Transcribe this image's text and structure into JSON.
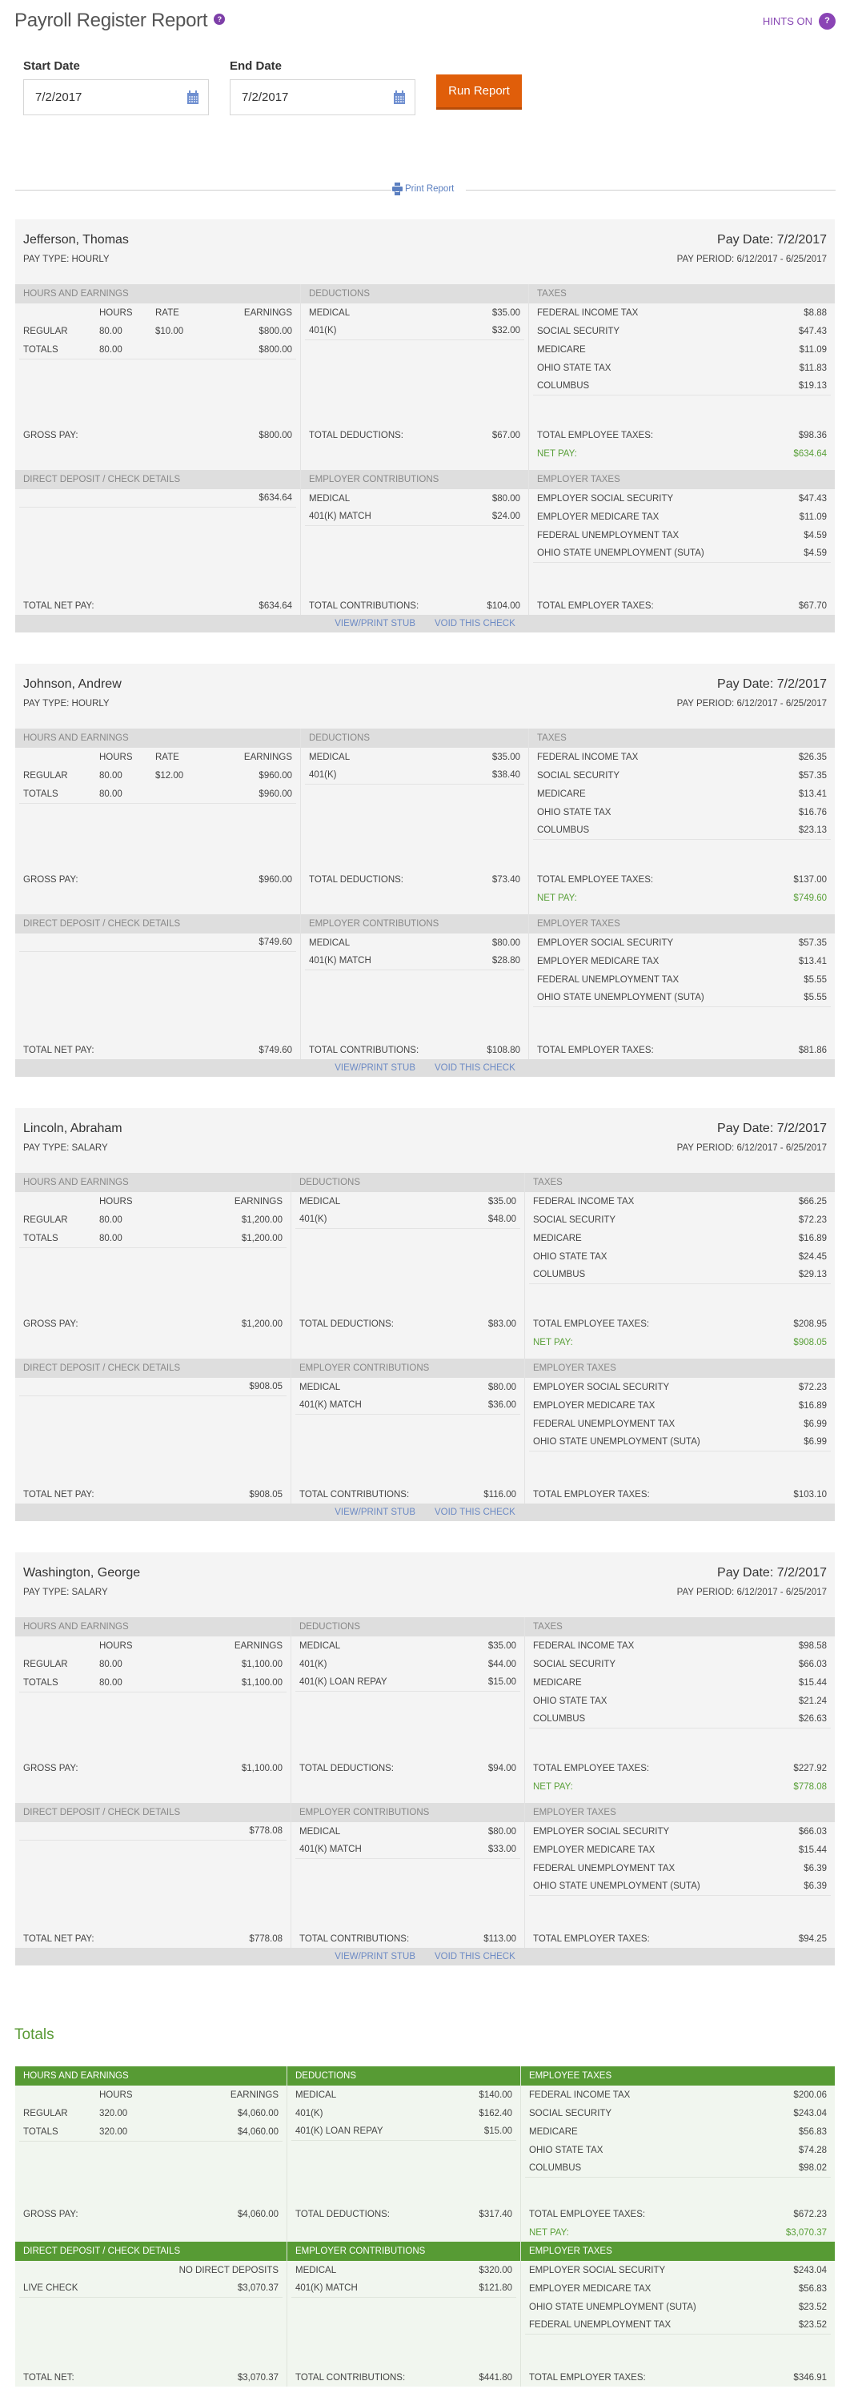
{
  "header": {
    "title": "Payroll Register Report",
    "title_help_icon": "?",
    "hints_label": "HINTS ON",
    "hints_icon": "?"
  },
  "filters": {
    "start_label": "Start Date",
    "start_value": "7/2/2017",
    "end_label": "End Date",
    "end_value": "7/2/2017",
    "run_button": "Run Report"
  },
  "print": {
    "label": "Print Report"
  },
  "labels": {
    "hours_and_earnings": "HOURS AND EARNINGS",
    "deductions": "DEDUCTIONS",
    "taxes": "TAXES",
    "employee_taxes": "EMPLOYEE TAXES",
    "direct_deposit": "DIRECT DEPOSIT / CHECK DETAILS",
    "employer_contributions": "EMPLOYER CONTRIBUTIONS",
    "employer_taxes": "EMPLOYER TAXES",
    "hours": "HOURS",
    "rate": "RATE",
    "earnings": "EARNINGS",
    "regular": "REGULAR",
    "totals": "TOTALS",
    "gross_pay": "GROSS PAY:",
    "total_deductions": "TOTAL DEDUCTIONS:",
    "total_employee_taxes": "TOTAL EMPLOYEE TAXES:",
    "net_pay": "NET PAY:",
    "total_net_pay": "TOTAL NET PAY:",
    "total_net": "TOTAL NET:",
    "total_contributions": "TOTAL CONTRIBUTIONS:",
    "total_employer_taxes": "TOTAL EMPLOYER TAXES:",
    "view_print_stub": "VIEW/PRINT STUB",
    "void_check": "VOID THIS CHECK"
  },
  "employees": [
    {
      "name": "Jefferson, Thomas",
      "pay_type": "PAY TYPE: HOURLY",
      "pay_date": "Pay Date: 7/2/2017",
      "pay_period": "PAY PERIOD: 6/12/2017 - 6/25/2017",
      "hourly": true,
      "regular": {
        "hours": "80.00",
        "rate": "$10.00",
        "earnings": "$800.00"
      },
      "totals": {
        "hours": "80.00",
        "earnings": "$800.00"
      },
      "gross_pay": "$800.00",
      "deductions": [
        {
          "label": "MEDICAL",
          "amount": "$35.00"
        },
        {
          "label": "401(K)",
          "amount": "$32.00"
        }
      ],
      "total_deductions": "$67.00",
      "taxes": [
        {
          "label": "FEDERAL INCOME TAX",
          "amount": "$8.88"
        },
        {
          "label": "SOCIAL SECURITY",
          "amount": "$47.43"
        },
        {
          "label": "MEDICARE",
          "amount": "$11.09"
        },
        {
          "label": "OHIO STATE TAX",
          "amount": "$11.83"
        },
        {
          "label": "COLUMBUS",
          "amount": "$19.13"
        }
      ],
      "total_employee_taxes": "$98.36",
      "net_pay": "$634.64",
      "direct_deposit": [
        {
          "label": "",
          "amount": "$634.64"
        }
      ],
      "total_net_pay": "$634.64",
      "employer_contributions": [
        {
          "label": "MEDICAL",
          "amount": "$80.00"
        },
        {
          "label": "401(K) MATCH",
          "amount": "$24.00"
        }
      ],
      "total_contributions": "$104.00",
      "employer_taxes": [
        {
          "label": "EMPLOYER SOCIAL SECURITY",
          "amount": "$47.43"
        },
        {
          "label": "EMPLOYER MEDICARE TAX",
          "amount": "$11.09"
        },
        {
          "label": "FEDERAL UNEMPLOYMENT TAX",
          "amount": "$4.59"
        },
        {
          "label": "OHIO STATE UNEMPLOYMENT (SUTA)",
          "amount": "$4.59"
        }
      ],
      "total_employer_taxes": "$67.70"
    },
    {
      "name": "Johnson, Andrew",
      "pay_type": "PAY TYPE: HOURLY",
      "pay_date": "Pay Date: 7/2/2017",
      "pay_period": "PAY PERIOD: 6/12/2017 - 6/25/2017",
      "hourly": true,
      "regular": {
        "hours": "80.00",
        "rate": "$12.00",
        "earnings": "$960.00"
      },
      "totals": {
        "hours": "80.00",
        "earnings": "$960.00"
      },
      "gross_pay": "$960.00",
      "deductions": [
        {
          "label": "MEDICAL",
          "amount": "$35.00"
        },
        {
          "label": "401(K)",
          "amount": "$38.40"
        }
      ],
      "total_deductions": "$73.40",
      "taxes": [
        {
          "label": "FEDERAL INCOME TAX",
          "amount": "$26.35"
        },
        {
          "label": "SOCIAL SECURITY",
          "amount": "$57.35"
        },
        {
          "label": "MEDICARE",
          "amount": "$13.41"
        },
        {
          "label": "OHIO STATE TAX",
          "amount": "$16.76"
        },
        {
          "label": "COLUMBUS",
          "amount": "$23.13"
        }
      ],
      "total_employee_taxes": "$137.00",
      "net_pay": "$749.60",
      "direct_deposit": [
        {
          "label": "",
          "amount": "$749.60"
        }
      ],
      "total_net_pay": "$749.60",
      "employer_contributions": [
        {
          "label": "MEDICAL",
          "amount": "$80.00"
        },
        {
          "label": "401(K) MATCH",
          "amount": "$28.80"
        }
      ],
      "total_contributions": "$108.80",
      "employer_taxes": [
        {
          "label": "EMPLOYER SOCIAL SECURITY",
          "amount": "$57.35"
        },
        {
          "label": "EMPLOYER MEDICARE TAX",
          "amount": "$13.41"
        },
        {
          "label": "FEDERAL UNEMPLOYMENT TAX",
          "amount": "$5.55"
        },
        {
          "label": "OHIO STATE UNEMPLOYMENT (SUTA)",
          "amount": "$5.55"
        }
      ],
      "total_employer_taxes": "$81.86"
    },
    {
      "name": "Lincoln, Abraham",
      "pay_type": "PAY TYPE: SALARY",
      "pay_date": "Pay Date: 7/2/2017",
      "pay_period": "PAY PERIOD: 6/12/2017 - 6/25/2017",
      "hourly": false,
      "regular": {
        "hours": "80.00",
        "earnings": "$1,200.00"
      },
      "totals": {
        "hours": "80.00",
        "earnings": "$1,200.00"
      },
      "gross_pay": "$1,200.00",
      "deductions": [
        {
          "label": "MEDICAL",
          "amount": "$35.00"
        },
        {
          "label": "401(K)",
          "amount": "$48.00"
        }
      ],
      "total_deductions": "$83.00",
      "taxes": [
        {
          "label": "FEDERAL INCOME TAX",
          "amount": "$66.25"
        },
        {
          "label": "SOCIAL SECURITY",
          "amount": "$72.23"
        },
        {
          "label": "MEDICARE",
          "amount": "$16.89"
        },
        {
          "label": "OHIO STATE TAX",
          "amount": "$24.45"
        },
        {
          "label": "COLUMBUS",
          "amount": "$29.13"
        }
      ],
      "total_employee_taxes": "$208.95",
      "net_pay": "$908.05",
      "direct_deposit": [
        {
          "label": "",
          "amount": "$908.05"
        }
      ],
      "total_net_pay": "$908.05",
      "employer_contributions": [
        {
          "label": "MEDICAL",
          "amount": "$80.00"
        },
        {
          "label": "401(K) MATCH",
          "amount": "$36.00"
        }
      ],
      "total_contributions": "$116.00",
      "employer_taxes": [
        {
          "label": "EMPLOYER SOCIAL SECURITY",
          "amount": "$72.23"
        },
        {
          "label": "EMPLOYER MEDICARE TAX",
          "amount": "$16.89"
        },
        {
          "label": "FEDERAL UNEMPLOYMENT TAX",
          "amount": "$6.99"
        },
        {
          "label": "OHIO STATE UNEMPLOYMENT (SUTA)",
          "amount": "$6.99"
        }
      ],
      "total_employer_taxes": "$103.10"
    },
    {
      "name": "Washington, George",
      "pay_type": "PAY TYPE: SALARY",
      "pay_date": "Pay Date: 7/2/2017",
      "pay_period": "PAY PERIOD: 6/12/2017 - 6/25/2017",
      "hourly": false,
      "regular": {
        "hours": "80.00",
        "earnings": "$1,100.00"
      },
      "totals": {
        "hours": "80.00",
        "earnings": "$1,100.00"
      },
      "gross_pay": "$1,100.00",
      "deductions": [
        {
          "label": "MEDICAL",
          "amount": "$35.00"
        },
        {
          "label": "401(K)",
          "amount": "$44.00"
        },
        {
          "label": "401(K) LOAN REPAY",
          "amount": "$15.00"
        }
      ],
      "total_deductions": "$94.00",
      "taxes": [
        {
          "label": "FEDERAL INCOME TAX",
          "amount": "$98.58"
        },
        {
          "label": "SOCIAL SECURITY",
          "amount": "$66.03"
        },
        {
          "label": "MEDICARE",
          "amount": "$15.44"
        },
        {
          "label": "OHIO STATE TAX",
          "amount": "$21.24"
        },
        {
          "label": "COLUMBUS",
          "amount": "$26.63"
        }
      ],
      "total_employee_taxes": "$227.92",
      "net_pay": "$778.08",
      "direct_deposit": [
        {
          "label": "",
          "amount": "$778.08"
        }
      ],
      "total_net_pay": "$778.08",
      "employer_contributions": [
        {
          "label": "MEDICAL",
          "amount": "$80.00"
        },
        {
          "label": "401(K) MATCH",
          "amount": "$33.00"
        }
      ],
      "total_contributions": "$113.00",
      "employer_taxes": [
        {
          "label": "EMPLOYER SOCIAL SECURITY",
          "amount": "$66.03"
        },
        {
          "label": "EMPLOYER MEDICARE TAX",
          "amount": "$15.44"
        },
        {
          "label": "FEDERAL UNEMPLOYMENT TAX",
          "amount": "$6.39"
        },
        {
          "label": "OHIO STATE UNEMPLOYMENT (SUTA)",
          "amount": "$6.39"
        }
      ],
      "total_employer_taxes": "$94.25"
    }
  ],
  "totals": {
    "title": "Totals",
    "regular": {
      "hours": "320.00",
      "earnings": "$4,060.00"
    },
    "totals": {
      "hours": "320.00",
      "earnings": "$4,060.00"
    },
    "gross_pay": "$4,060.00",
    "deductions": [
      {
        "label": "MEDICAL",
        "amount": "$140.00"
      },
      {
        "label": "401(K)",
        "amount": "$162.40"
      },
      {
        "label": "401(K) LOAN REPAY",
        "amount": "$15.00"
      }
    ],
    "total_deductions": "$317.40",
    "taxes": [
      {
        "label": "FEDERAL INCOME TAX",
        "amount": "$200.06"
      },
      {
        "label": "SOCIAL SECURITY",
        "amount": "$243.04"
      },
      {
        "label": "MEDICARE",
        "amount": "$56.83"
      },
      {
        "label": "OHIO STATE TAX",
        "amount": "$74.28"
      },
      {
        "label": "COLUMBUS",
        "amount": "$98.02"
      }
    ],
    "total_employee_taxes": "$672.23",
    "net_pay": "$3,070.37",
    "direct_deposit": [
      {
        "label": "",
        "amount": "NO DIRECT DEPOSITS"
      },
      {
        "label": "LIVE CHECK",
        "amount": "$3,070.37"
      }
    ],
    "total_net": "$3,070.37",
    "employer_contributions": [
      {
        "label": "MEDICAL",
        "amount": "$320.00"
      },
      {
        "label": "401(K) MATCH",
        "amount": "$121.80"
      }
    ],
    "total_contributions": "$441.80",
    "employer_taxes": [
      {
        "label": "EMPLOYER SOCIAL SECURITY",
        "amount": "$243.04"
      },
      {
        "label": "EMPLOYER MEDICARE TAX",
        "amount": "$56.83"
      },
      {
        "label": "OHIO STATE UNEMPLOYMENT (SUTA)",
        "amount": "$23.52"
      },
      {
        "label": "FEDERAL UNEMPLOYMENT TAX",
        "amount": "$23.52"
      }
    ],
    "total_employer_taxes": "$346.91"
  },
  "colors": {
    "accent_orange": "#e05e0a",
    "hints_purple": "#8a44b5",
    "totals_green": "#579b34",
    "net_pay_green": "#5aa03a",
    "link_blue": "#6c8ac4"
  }
}
